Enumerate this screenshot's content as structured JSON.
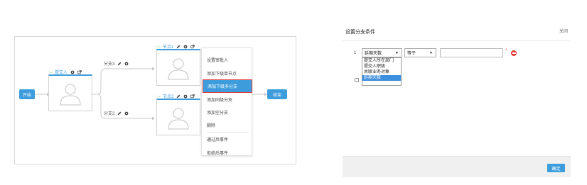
{
  "flow": {
    "start_label": "开始",
    "end_label": "结束",
    "submitter_label": "提交人",
    "node1_label": "节点1",
    "node2_label": "节点2",
    "branch3_label": "分支3",
    "branch2_label": "分支2"
  },
  "context_menu": {
    "items": [
      "设置审批人",
      "添加下级单节点",
      "添加下级多分支",
      "添加同级分支",
      "添加空分支",
      "删除",
      "通过后事件",
      "拒绝后事件"
    ],
    "highlighted": "添加下级多分支"
  },
  "dialog": {
    "title": "设置分支条件",
    "close_label": "关闭",
    "row_number": "1",
    "field_value": "延期天数",
    "operator_value": "等于",
    "value_text": "",
    "required_mark": "*",
    "field_options": [
      "提交人所在部门",
      "提交人职级",
      "关联业务对象",
      "延期天数"
    ],
    "selected_option": "延期天数",
    "confirm_label": "确定"
  },
  "colors": {
    "accent": "#3d9ddc",
    "highlight_border": "#e03c3c",
    "remove": "#e23b3b",
    "option_selected": "#3d8fe0"
  },
  "icons": [
    "pencil-icon",
    "gear-icon",
    "external-link-icon",
    "user-avatar-icon",
    "minus-circle-icon",
    "caret-down-icon"
  ]
}
